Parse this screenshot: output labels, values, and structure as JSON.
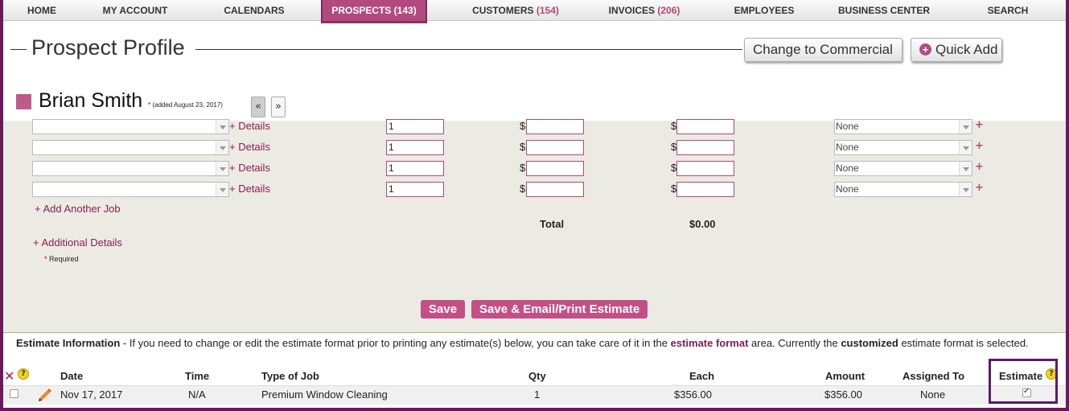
{
  "nav": {
    "items": [
      {
        "label": "HOME",
        "count": ""
      },
      {
        "label": "MY ACCOUNT",
        "count": ""
      },
      {
        "label": "CALENDARS",
        "count": ""
      },
      {
        "label": "PROSPECTS",
        "count": "(143)"
      },
      {
        "label": "CUSTOMERS",
        "count": "(154)"
      },
      {
        "label": "INVOICES",
        "count": "(206)"
      },
      {
        "label": "EMPLOYEES",
        "count": ""
      },
      {
        "label": "BUSINESS CENTER",
        "count": ""
      },
      {
        "label": "SEARCH",
        "count": ""
      }
    ],
    "active": "PROSPECTS"
  },
  "header": {
    "title": "Prospect Profile",
    "change_commercial": "Change to Commercial",
    "quick_add": "Quick Add"
  },
  "profile": {
    "name": "Brian Smith",
    "added": "* (added August 23, 2017)",
    "prev": "«",
    "next": "»"
  },
  "jobs": {
    "rows": [
      {
        "job": "",
        "details": "+ Details",
        "qty": "1",
        "each_prefix": "$",
        "each": "",
        "amount_prefix": "$",
        "amount": "",
        "assigned": "None",
        "plus": "+"
      },
      {
        "job": "",
        "details": "+ Details",
        "qty": "1",
        "each_prefix": "$",
        "each": "",
        "amount_prefix": "$",
        "amount": "",
        "assigned": "None",
        "plus": "+"
      },
      {
        "job": "",
        "details": "+ Details",
        "qty": "1",
        "each_prefix": "$",
        "each": "",
        "amount_prefix": "$",
        "amount": "",
        "assigned": "None",
        "plus": "+"
      },
      {
        "job": "",
        "details": "+ Details",
        "qty": "1",
        "each_prefix": "$",
        "each": "",
        "amount_prefix": "$",
        "amount": "",
        "assigned": "None",
        "plus": "+"
      }
    ],
    "add_another": "+ Add Another Job",
    "total_label": "Total",
    "total_value": "$0.00",
    "additional": "+ Additional Details",
    "required_star": "*",
    "required": " Required",
    "save": "Save",
    "save_email": "Save & Email/Print Estimate"
  },
  "estimate_info": {
    "title": "Estimate Information",
    "text1": " - If you need to change or edit the estimate format prior to printing any estimate(s) below, you can take care of it in the ",
    "link": "estimate format",
    "text2": " area. Currently the ",
    "format": "customized",
    "text3": " estimate format is selected."
  },
  "table": {
    "headers": {
      "date": "Date",
      "time": "Time",
      "type": "Type of Job",
      "qty": "Qty",
      "each": "Each",
      "amount": "Amount",
      "assigned": "Assigned To",
      "estimate": "Estimate"
    },
    "rows": [
      {
        "date": "Nov 17, 2017",
        "time": "N/A",
        "type": "Premium Window Cleaning",
        "qty": "1",
        "each": "$356.00",
        "amount": "$356.00",
        "assigned": "None",
        "estimate_checked": true
      }
    ]
  },
  "colors": {
    "accent": "#b24a7f",
    "frame": "#6a1a5c",
    "link": "#8b1d4f",
    "help": "#f2d21c"
  }
}
